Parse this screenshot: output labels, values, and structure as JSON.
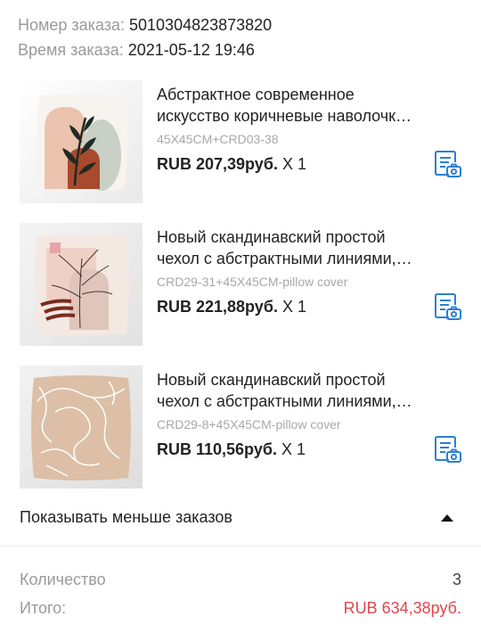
{
  "order": {
    "number_label": "Номер заказа: ",
    "number": "5010304823873820",
    "time_label": "Время заказа: ",
    "time": "2021-05-12 19:46"
  },
  "items": [
    {
      "title": "Абстрактное современное искусство коричневые наволочки ...",
      "sku": "45X45CM+CRD03-38",
      "price": "RUB 207,39руб.",
      "qty": "X 1",
      "thumb_icon": "pillow-leaf-icon"
    },
    {
      "title": "Новый скандинавский простой чехол с абстрактными линиями, де...",
      "sku": "CRD29-31+45X45CM-pillow cover",
      "price": "RUB 221,88руб.",
      "qty": "X 1",
      "thumb_icon": "pillow-line-plant-icon"
    },
    {
      "title": "Новый скандинавский простой чехол с абстрактными линиями, де...",
      "sku": "CRD29-8+45X45CM-pillow cover",
      "price": "RUB 110,56руб.",
      "qty": "X 1",
      "thumb_icon": "pillow-abstract-lines-icon"
    }
  ],
  "toggle": {
    "label": "Показывать меньше заказов",
    "icon": "caret-up-icon"
  },
  "summary": {
    "quantity_label": "Количество",
    "quantity_value": "3",
    "total_label": "Итого:",
    "total_value": "RUB 634,38руб."
  },
  "colors": {
    "accent_icon": "#2d7fd3",
    "total_red": "#e0464a",
    "muted_text": "#9a9a9a"
  }
}
